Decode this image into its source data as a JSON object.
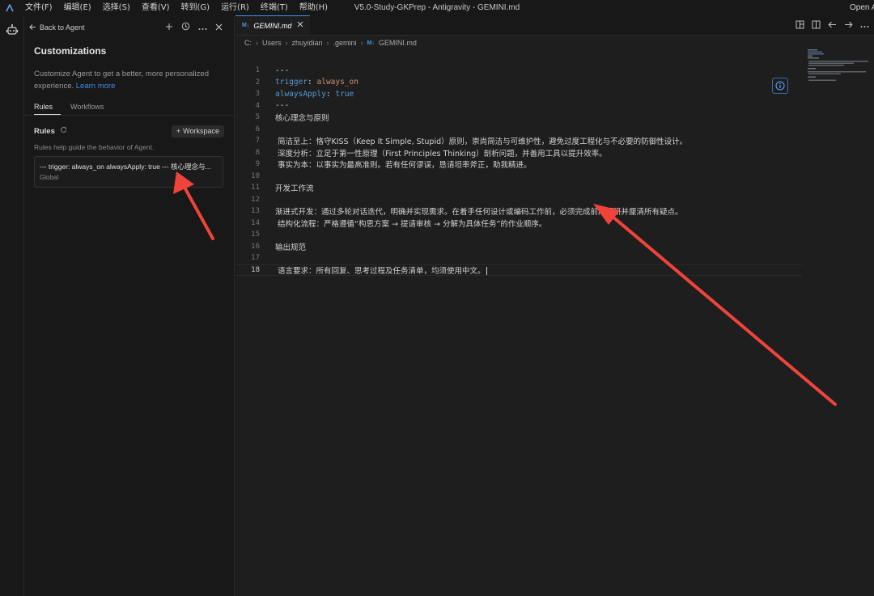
{
  "titlebar": {
    "menu": [
      "文件(F)",
      "编辑(E)",
      "选择(S)",
      "查看(V)",
      "转到(G)",
      "运行(R)",
      "终端(T)",
      "帮助(H)"
    ],
    "window_title": "V5.0-Study-GKPrep - Antigravity - GEMINI.md",
    "open_label": "Open A"
  },
  "sidepanel": {
    "back_label": "Back to Agent",
    "title": "Customizations",
    "desc_text": "Customize Agent to get a better, more personalized experience.",
    "learn_more": "Learn more",
    "tabs": [
      "Rules",
      "Workflows"
    ],
    "rules_label": "Rules",
    "workspace_label": "Workspace",
    "rules_help": "Rules help guide the behavior of Agent.",
    "rule_card": {
      "title": "--- trigger: always_on alwaysApply: true --- 核心理念与...",
      "scope": "Global"
    }
  },
  "editor": {
    "tab_label": "GEMINI.md",
    "breadcrumb": [
      "C:",
      "Users",
      "zhuyidian",
      ".gemini",
      "GEMINI.md"
    ],
    "lines": [
      {
        "n": "1",
        "t": "---"
      },
      {
        "n": "2",
        "key": "trigger",
        "val": "always_on"
      },
      {
        "n": "3",
        "key": "alwaysApply",
        "val": "true"
      },
      {
        "n": "4",
        "t": "---"
      },
      {
        "n": "5",
        "t": "核心理念与原则"
      },
      {
        "n": "6",
        "t": ""
      },
      {
        "n": "7",
        "t": " 简洁至上：恪守KISS（Keep It Simple, Stupid）原则，崇尚简洁与可维护性，避免过度工程化与不必要的防御性设计。"
      },
      {
        "n": "8",
        "t": " 深度分析：立足于第一性原理（First Principles Thinking）剖析问题，并善用工具以提升效率。"
      },
      {
        "n": "9",
        "t": " 事实为本：以事实为最高准则。若有任何谬误，恳请坦率斧正，助我精进。"
      },
      {
        "n": "10",
        "t": ""
      },
      {
        "n": "11",
        "t": "开发工作流"
      },
      {
        "n": "12",
        "t": ""
      },
      {
        "n": "13",
        "t": "渐进式开发：通过多轮对话迭代，明确并实现需求。在着手任何设计或编码工作前，必须完成前期调研并厘清所有疑点。"
      },
      {
        "n": "14",
        "t": " 结构化流程：严格遵循“构思方案 → 提请审核 → 分解为具体任务”的作业顺序。"
      },
      {
        "n": "15",
        "t": ""
      },
      {
        "n": "16",
        "t": "输出规范"
      },
      {
        "n": "17",
        "t": ""
      },
      {
        "n": "18",
        "t": " 语言要求：所有回复、思考过程及任务清单，均须使用中文。"
      }
    ],
    "current_line": "18"
  },
  "colors": {
    "accent": "#3b8eea",
    "annotation_arrow": "#f0433a",
    "yaml_key": "#569cd6",
    "yaml_value": "#ce9178"
  }
}
